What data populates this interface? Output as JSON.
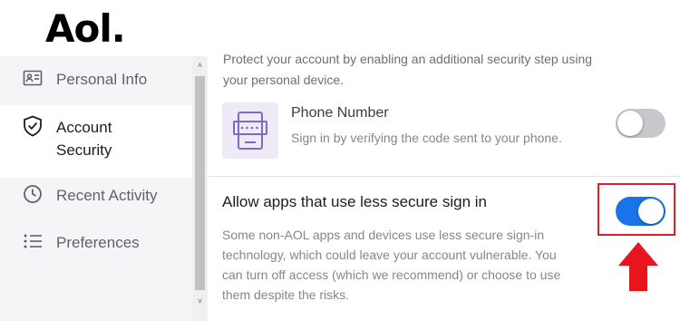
{
  "brand": {
    "logo_text": "Aol."
  },
  "sidebar": {
    "items": [
      {
        "label": "Personal Info",
        "icon": "id-card-icon",
        "active": false
      },
      {
        "label": "Account Security",
        "icon": "shield-check-icon",
        "active": true
      },
      {
        "label": "Recent Activity",
        "icon": "clock-icon",
        "active": false
      },
      {
        "label": "Preferences",
        "icon": "list-icon",
        "active": false
      }
    ]
  },
  "content": {
    "intro_text": "Protect your account by enabling an additional security step using your personal device.",
    "phone_number": {
      "title": "Phone Number",
      "description": "Sign in by verifying the code sent to your phone.",
      "enabled": false
    },
    "less_secure": {
      "title": "Allow apps that use less secure sign in",
      "description": "Some non-AOL apps and devices use less secure sign-in technology, which could leave your account vulnerable. You can turn off access (which we recommend) or choose to use them despite the risks.",
      "enabled": true
    }
  },
  "colors": {
    "toggle_on": "#1a73e8",
    "toggle_off": "#c7c7cc",
    "annotation_red": "#d6232f",
    "phone_icon_bg": "#eeeaf8",
    "phone_icon_stroke": "#7d6bc1"
  }
}
